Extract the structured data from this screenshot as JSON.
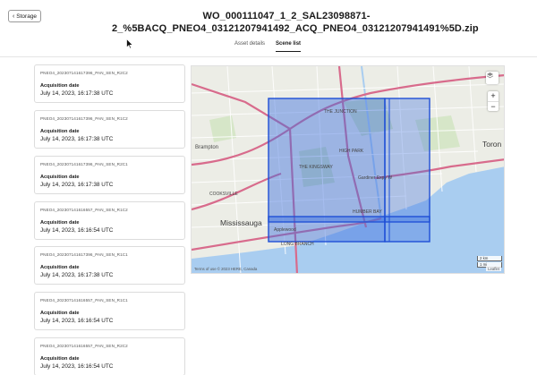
{
  "header": {
    "back_label": "Storage",
    "title": "WO_000111047_1_2_SAL23098871-2_%5BACQ_PNEO4_03121207941492_ACQ_PNEO4_03121207941491%5D.zip",
    "tabs": [
      {
        "label": "Asset details",
        "active": false
      },
      {
        "label": "Scene list",
        "active": true
      }
    ]
  },
  "scenes": [
    {
      "id": "PNEO4_202307141617396_PAN_SEN_R2C2",
      "label": "Acquisition date",
      "date": "July 14, 2023, 16:17:38 UTC"
    },
    {
      "id": "PNEO4_202307141617396_PAN_SEN_R1C2",
      "label": "Acquisition date",
      "date": "July 14, 2023, 16:17:38 UTC"
    },
    {
      "id": "PNEO4_202307141617396_PAN_SEN_R2C1",
      "label": "Acquisition date",
      "date": "July 14, 2023, 16:17:38 UTC"
    },
    {
      "id": "PNEO4_202307141616557_PAN_SEN_R1C2",
      "label": "Acquisition date",
      "date": "July 14, 2023, 16:16:54 UTC"
    },
    {
      "id": "PNEO4_202307141617396_PAN_SEN_R1C1",
      "label": "Acquisition date",
      "date": "July 14, 2023, 16:17:38 UTC"
    },
    {
      "id": "PNEO4_202307141616557_PAN_SEN_R1C1",
      "label": "Acquisition date",
      "date": "July 14, 2023, 16:16:54 UTC"
    },
    {
      "id": "PNEO4_202307141616557_PAN_SEN_R2C2",
      "label": "Acquisition date",
      "date": "July 14, 2023, 16:16:54 UTC"
    }
  ],
  "map": {
    "labels": {
      "toronto": "Toron",
      "mississauga": "Mississauga",
      "brampton": "Brampton",
      "gardiner": "Gardiner Expy W",
      "applewood": "Applewood",
      "high_park": "HIGH PARK",
      "the_junction": "THE JUNCTION",
      "kingsway": "THE KINGSWAY",
      "humber_bay": "HUMBER BAY",
      "long_branch": "LONG BRANCH",
      "cooksville": "COOKSVILLE"
    },
    "zoom_in": "+",
    "zoom_out": "−",
    "scale_km": "2 km",
    "scale_mi": "1 mi",
    "attribution": "Terms of use  © 2023 HERE, Canada",
    "leaflet": "Leaflet",
    "colors": {
      "footprint_fill": "#3b6fe0",
      "footprint_stroke": "#1f4fd6",
      "water": "#a9cdf0",
      "highway": "#d86b8c"
    }
  }
}
